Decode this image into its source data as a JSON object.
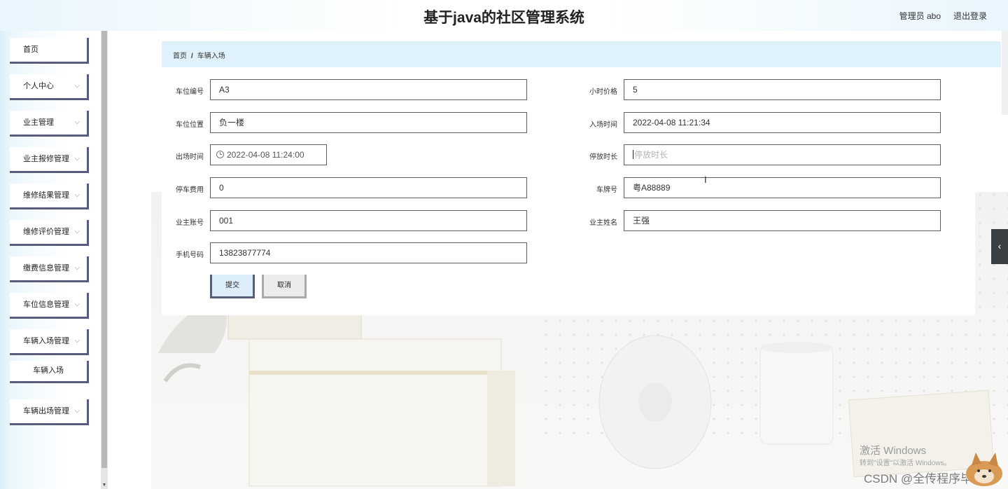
{
  "header": {
    "title": "基于java的社区管理系统",
    "user": "管理员 abo",
    "logout": "退出登录"
  },
  "sidebar": {
    "items": [
      {
        "label": "首页",
        "has_children": false
      },
      {
        "label": "个人中心",
        "has_children": true
      },
      {
        "label": "业主管理",
        "has_children": true
      },
      {
        "label": "业主报修管理",
        "has_children": true
      },
      {
        "label": "维修结果管理",
        "has_children": true
      },
      {
        "label": "维修评价管理",
        "has_children": true
      },
      {
        "label": "缴费信息管理",
        "has_children": true
      },
      {
        "label": "车位信息管理",
        "has_children": true
      },
      {
        "label": "车辆入场管理",
        "has_children": true,
        "expanded": true
      },
      {
        "label": "车辆入场",
        "sub": true
      },
      {
        "label": "车辆出场管理",
        "has_children": true
      }
    ],
    "chevron_icon": "chevron-down-icon"
  },
  "breadcrumb": {
    "home": "首页",
    "separator": "/",
    "current": "车辆入场"
  },
  "form": {
    "parking_no": {
      "label": "车位编号",
      "value": "A3"
    },
    "hourly_price": {
      "label": "小时价格",
      "value": "5"
    },
    "parking_location": {
      "label": "车位位置",
      "value": "负一楼"
    },
    "entry_time": {
      "label": "入场时间",
      "value": "2022-04-08 11:21:34"
    },
    "exit_time": {
      "label": "出场时间",
      "value": "2022-04-08 11:24:00"
    },
    "parking_duration": {
      "label": "停放时长",
      "value": "",
      "placeholder": "停放时长"
    },
    "parking_fee": {
      "label": "停车费用",
      "value": "0"
    },
    "plate_no": {
      "label": "车牌号",
      "value": "粤A88889"
    },
    "owner_account": {
      "label": "业主账号",
      "value": "001"
    },
    "owner_name": {
      "label": "业主姓名",
      "value": "王强"
    },
    "phone": {
      "label": "手机号码",
      "value": "13823877774"
    },
    "submit_label": "提交",
    "cancel_label": "取消"
  },
  "right_toggle_icon": "‹",
  "watermark": {
    "line1": "激活 Windows",
    "line2": "转到\"设置\"以激活 Windows。",
    "line3": "CSDN @全传程序毕设"
  },
  "colors": {
    "breadcrumb_bg": "#dff1fb",
    "menu_border": "#5a5c7c",
    "submit_bg": "#dceefa"
  }
}
